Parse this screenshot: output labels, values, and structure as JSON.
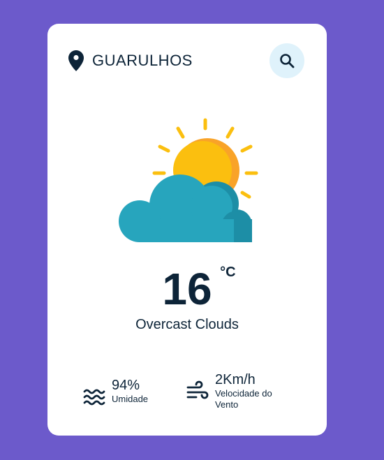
{
  "location": {
    "icon": "map-pin-icon",
    "city": "GUARULHOS"
  },
  "search": {
    "icon": "search-icon"
  },
  "weather": {
    "icon": "sun-behind-cloud-icon",
    "temperature": "16",
    "unit": "°C",
    "description": "Overcast Clouds"
  },
  "stats": {
    "humidity": {
      "icon": "waves-icon",
      "value": "94%",
      "label": "Umidade"
    },
    "wind": {
      "icon": "wind-icon",
      "value": "2Km/h",
      "label": "Velocidade do Vento"
    }
  },
  "colors": {
    "background": "#6c5acb",
    "card": "#ffffff",
    "text": "#0d2438",
    "search_bg": "#dff2fb",
    "sun": "#fbbf0f",
    "cloud": "#27a5bd"
  }
}
